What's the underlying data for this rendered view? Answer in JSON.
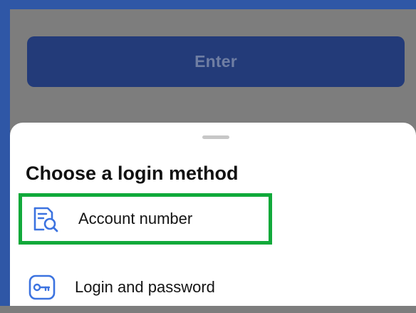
{
  "login_screen": {
    "enter_label": "Enter"
  },
  "sheet": {
    "title": "Choose a login method",
    "options": [
      {
        "label": "Account number",
        "icon": "document-search-icon",
        "highlighted": true
      },
      {
        "label": "Login and password",
        "icon": "key-icon",
        "highlighted": false
      }
    ]
  },
  "colors": {
    "brand_blue": "#2f57a6",
    "button_blue": "#233b79",
    "icon_blue": "#3c73e0",
    "highlight_green": "#10a93a",
    "overlay_gray": "#7d7d7d"
  }
}
